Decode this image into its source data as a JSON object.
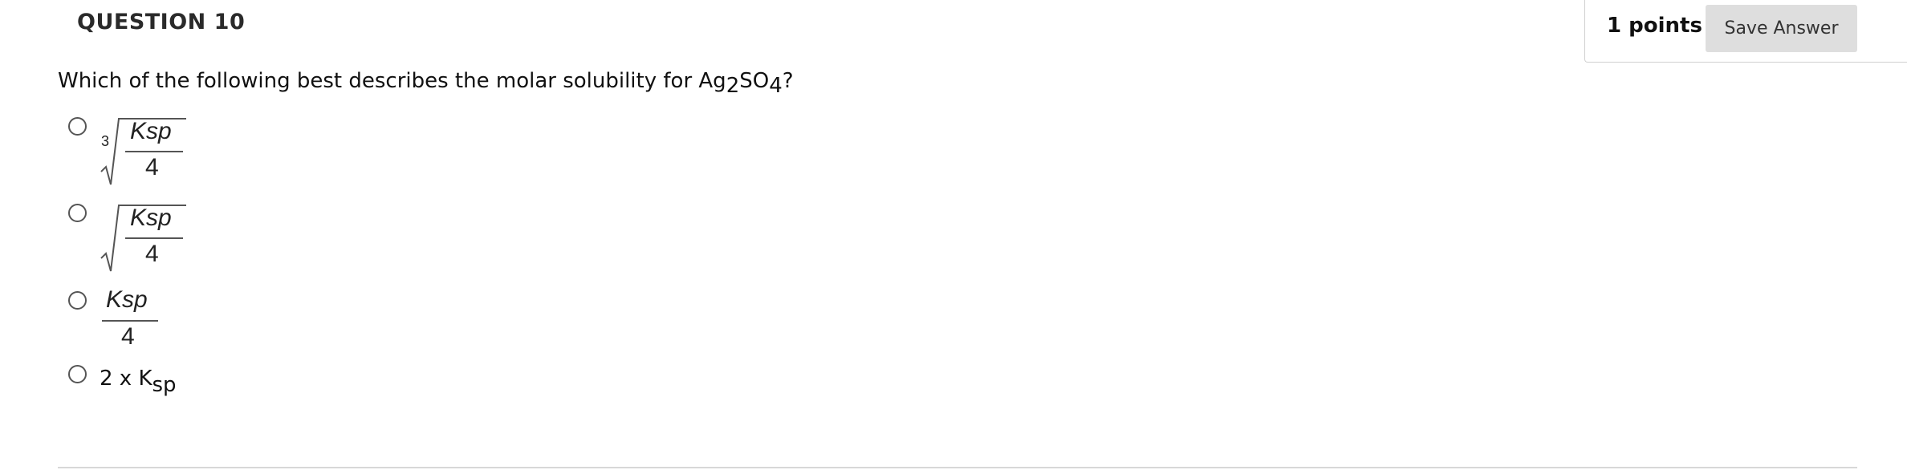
{
  "header": {
    "question_title": "QUESTION 10",
    "points": "1 points",
    "save_label": "Save Answer"
  },
  "question": {
    "text_before": "Which of the following best describes the molar solubility for Ag",
    "sub1": "2",
    "text_mid": "SO",
    "sub2": "4",
    "text_after": "?"
  },
  "options": [
    {
      "root_index": "3",
      "numerator": "Ksp",
      "denominator": "4"
    },
    {
      "numerator": "Ksp",
      "denominator": "4"
    },
    {
      "numerator": "Ksp",
      "denominator": "4"
    },
    {
      "prefix": "2 x K",
      "subscript": "sp"
    }
  ]
}
